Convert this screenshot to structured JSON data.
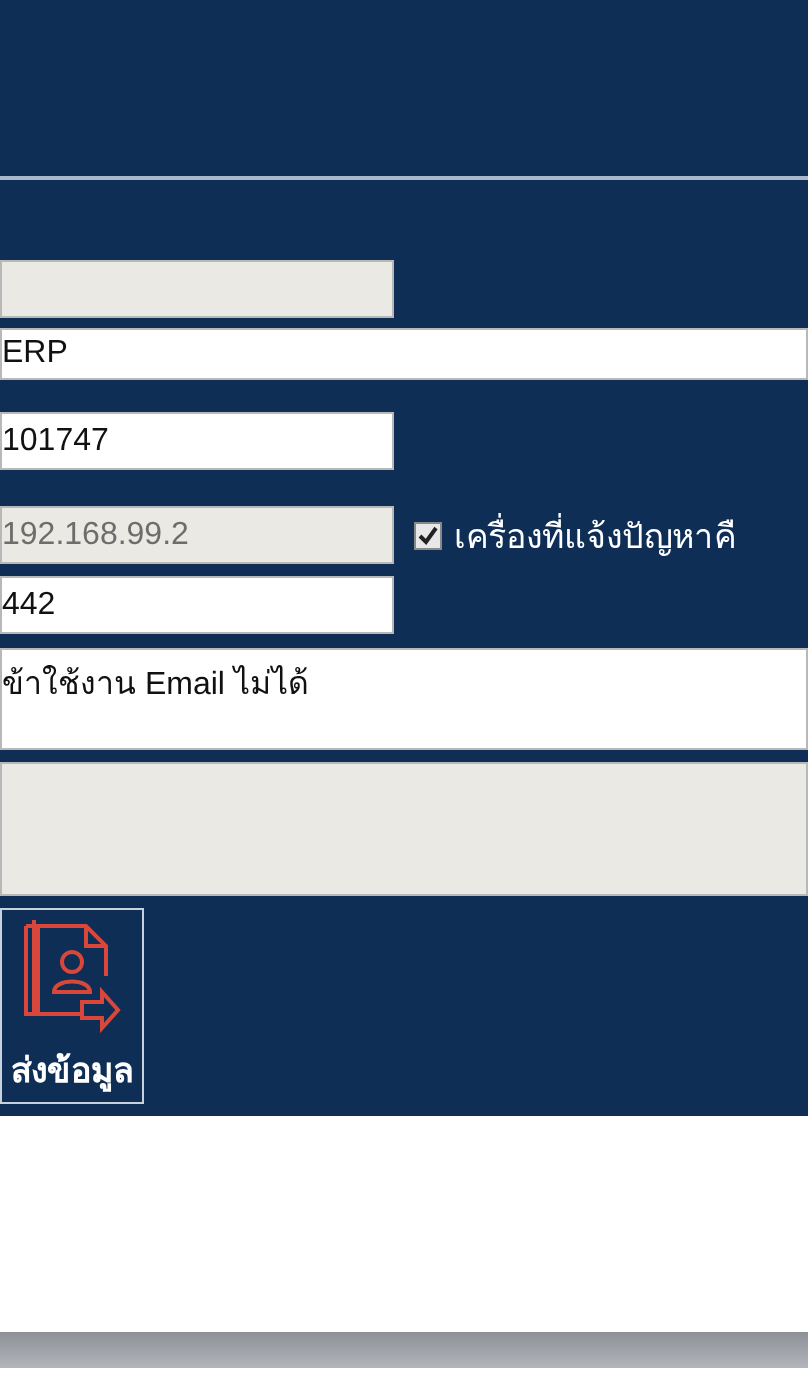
{
  "form": {
    "fields": [
      {
        "kind": "input",
        "disabled": true
      },
      {
        "kind": "wide",
        "value": "ERP",
        "disabled": false
      },
      {
        "kind": "input",
        "value": "101747",
        "disabled": false
      },
      {
        "kind": "input",
        "value": "192.168.99.2",
        "disabled": true,
        "checkbox": {
          "label": "เครื่องที่แจ้งปัญหาคื",
          "checked": true
        }
      },
      {
        "kind": "input",
        "value": "442",
        "disabled": false
      },
      {
        "kind": "textarea",
        "value": "ข้าใช้งาน Email ไม่ได้",
        "disabled": false
      },
      {
        "kind": "textarea",
        "disabled": true
      }
    ]
  },
  "submit": {
    "label": "ส่งข้อมูล"
  }
}
